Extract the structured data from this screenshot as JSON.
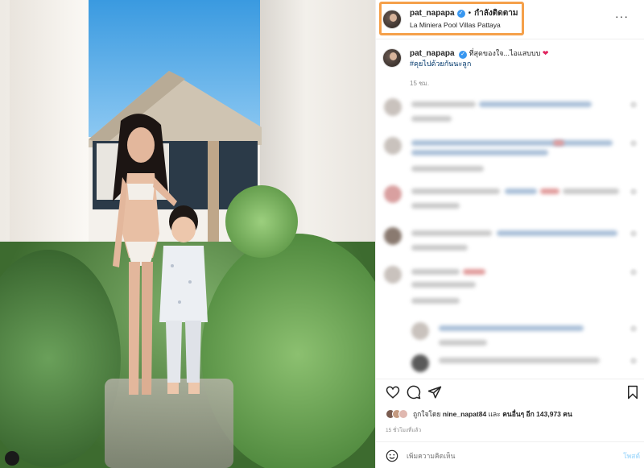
{
  "post": {
    "username": "pat_napapa",
    "verified_icon": "verified-badge-icon",
    "separator": "•",
    "follow_label": "กำลังติดตาม",
    "location": "La Miniera Pool Villas Pattaya",
    "more_icon": "more-options-icon",
    "more_glyph": "···"
  },
  "caption": {
    "username": "pat_napapa",
    "text": "ที่สุดของใจ...ไอแสบบบ",
    "heart": "❤",
    "hashtag": "#คุยไปด้วยกันนะลูก",
    "time": "15 ชม."
  },
  "actions": {
    "like_icon": "heart-icon",
    "comment_icon": "comment-icon",
    "share_icon": "share-icon",
    "save_icon": "bookmark-icon"
  },
  "likes": {
    "prefix": "ถูกใจโดย",
    "user": "nine_napat84",
    "middle": "และ",
    "others": "คนอื่นๆ อีก 143,973 คน"
  },
  "post_time": "15 ชั่วโมงที่แล้ว",
  "comment_box": {
    "placeholder": "เพิ่มความคิดเห็น",
    "post_label": "โพสต์",
    "emoji_icon": "emoji-icon"
  },
  "colors": {
    "highlight": "#f5a04a",
    "verified": "#3897f0",
    "hashtag": "#00376b",
    "post_button": "#b2dffc"
  }
}
